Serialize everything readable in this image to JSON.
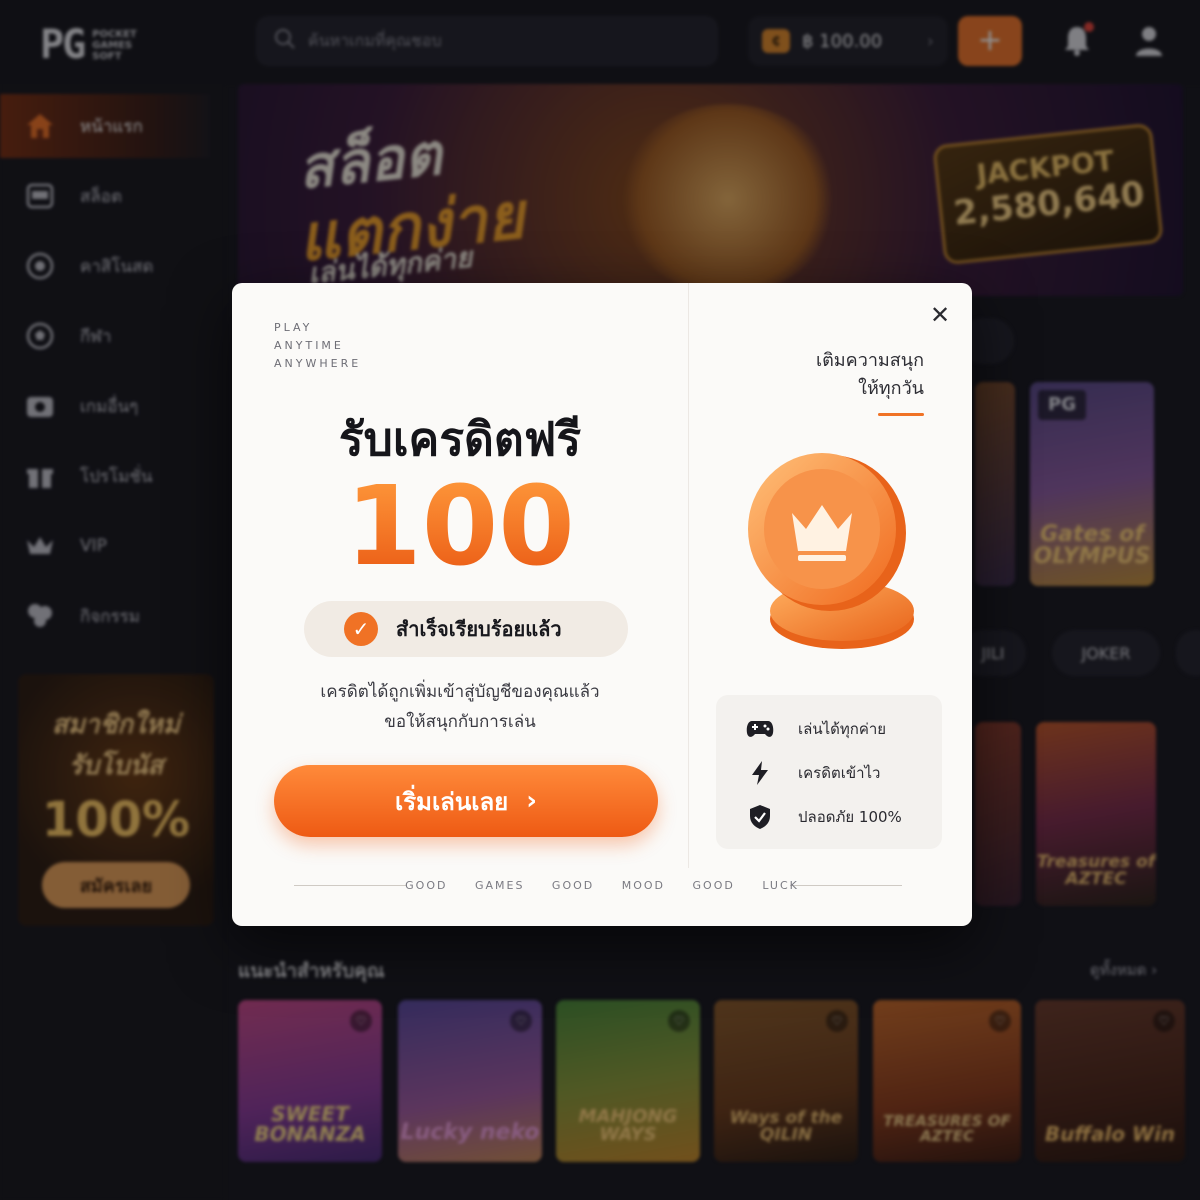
{
  "header": {
    "logo": {
      "mark": "PG",
      "sub_line1": "POCKET",
      "sub_line2": "GAMES",
      "sub_line3": "SOFT"
    },
    "search_placeholder": "ค้นหาเกมที่คุณชอบ",
    "balance": "฿ 100.00",
    "deposit_symbol": "+",
    "icons": [
      "search-icon",
      "wallet-icon",
      "bell-icon",
      "user-icon"
    ]
  },
  "sidebar": {
    "items": [
      {
        "label": "หน้าแรก",
        "icon": "home-icon",
        "active": true
      },
      {
        "label": "สล็อต",
        "icon": "slot-machine-icon"
      },
      {
        "label": "คาสิโนสด",
        "icon": "casino-chip-icon"
      },
      {
        "label": "กีฬา",
        "icon": "soccer-ball-icon"
      },
      {
        "label": "เกมอื่นๆ",
        "icon": "wallet-icon"
      },
      {
        "label": "โปรโมชั่น",
        "icon": "gift-icon"
      },
      {
        "label": "VIP",
        "icon": "crown-icon"
      },
      {
        "label": "กิจกรรม",
        "icon": "activity-icon"
      }
    ],
    "promo": {
      "line1": "สมาชิกใหม่",
      "line2": "รับโบนัส",
      "line3": "100%",
      "button": "สมัครเลย"
    }
  },
  "banner": {
    "line1": "สล็อต",
    "line2": "แตกง่าย",
    "line3": "เล่นได้ทุกค่าย",
    "jackpot_label": "JACKPOT",
    "jackpot_value": "2,580,640"
  },
  "provider_chips": [
    "JILI",
    "JOKER"
  ],
  "game_tiles_right": [
    {
      "title": "Gates of OLYMPUS",
      "badge": "PG"
    },
    {
      "title": "Treasures of AZTEC"
    }
  ],
  "recommended": {
    "title": "แนะนำสำหรับคุณ",
    "see_all": "ดูทั้งหมด",
    "games": [
      {
        "name": "SWEET BONANZA"
      },
      {
        "name": "Lucky neko"
      },
      {
        "name": "MAHJONG WAYS"
      },
      {
        "name": "Ways of the QILIN"
      },
      {
        "name": "TREASURES OF AZTEC"
      },
      {
        "name": "Buffalo Win"
      }
    ]
  },
  "modal": {
    "tagline": [
      "PLAY",
      "ANYTIME",
      "ANYWHERE"
    ],
    "headline": "รับเครดิตฟรี",
    "amount": "100",
    "success_text": "สำเร็จเรียบร้อยแล้ว",
    "description_line1": "เครดิตได้ถูกเพิ่มเข้าสู่บัญชีของคุณแล้ว",
    "description_line2": "ขอให้สนุกกับการเล่น",
    "cta_label": "เริ่มเล่นเลย",
    "side_title_line1": "เติมความสนุก",
    "side_title_line2": "ให้ทุกวัน",
    "features": [
      {
        "label": "เล่นได้ทุกค่าย",
        "icon": "gamepad-icon"
      },
      {
        "label": "เครดิตเข้าไว",
        "icon": "lightning-icon"
      },
      {
        "label": "ปลอดภัย 100%",
        "icon": "shield-check-icon"
      }
    ],
    "footer": [
      "GOOD GAMES",
      "GOOD MOOD",
      "GOOD LUCK"
    ]
  },
  "colors": {
    "accent": "#f07225",
    "background": "#16161e",
    "modal_bg": "#fbfaf8"
  }
}
